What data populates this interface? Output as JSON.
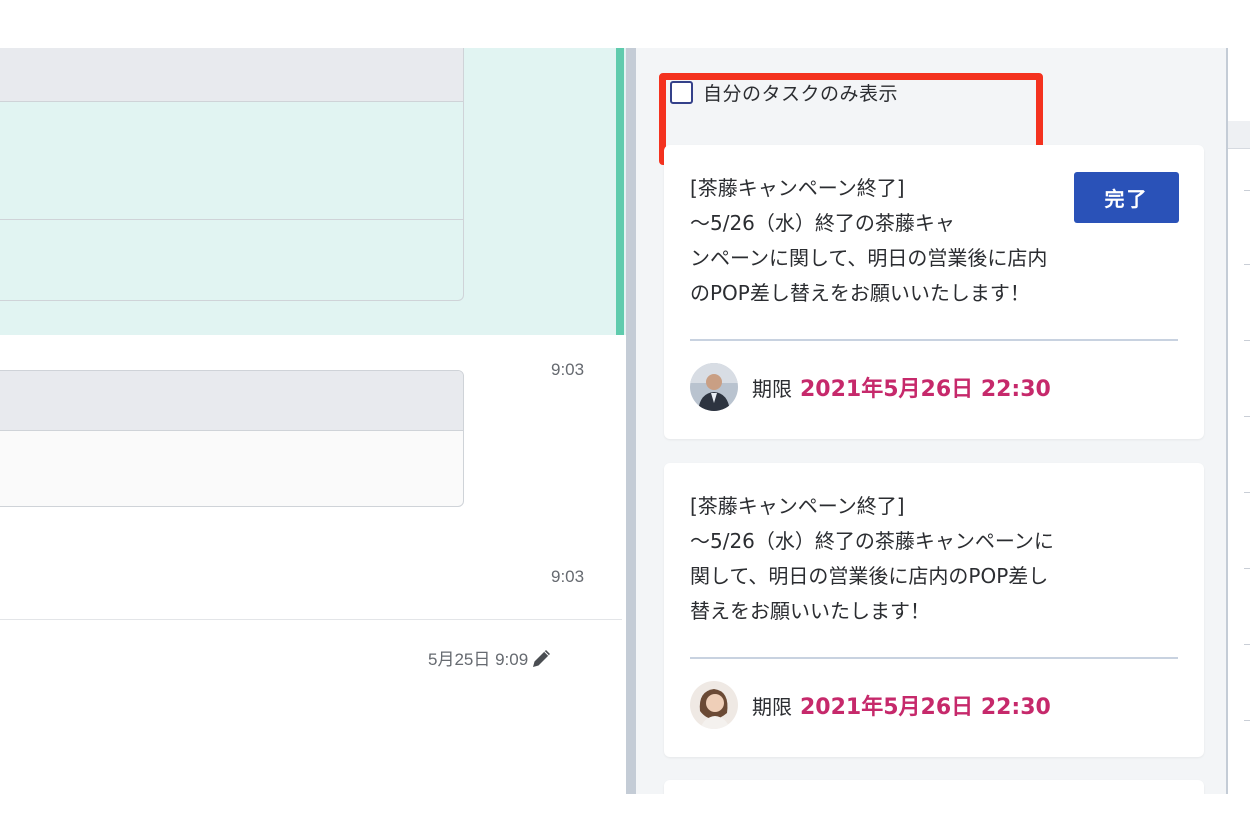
{
  "chat": {
    "times": [
      "9:03",
      "9:03"
    ],
    "edit_stamp": "5月25日 9:09"
  },
  "task_panel": {
    "filter_label": "自分のタスクのみ表示",
    "filter_checked": false,
    "tasks": [
      {
        "body": "[茶藤キャンペーン終了]\n〜5/26（水）終了の茶藤キャ\nンペーンに関して、明日の営業後に店内\nのPOP差し替えをお願いいたします！",
        "complete_label": "完了",
        "due_label": "期限",
        "due_date": "2021年5月26日 22:30"
      },
      {
        "body": "[茶藤キャンペーン終了]\n〜5/26（水）終了の茶藤キャンペーンに\n関して、明日の営業後に店内のPOP差し\n替えをお願いいたします！",
        "due_label": "期限",
        "due_date": "2021年5月26日 22:30"
      }
    ]
  },
  "colors": {
    "accent_blue": "#2a52b8",
    "due_pink": "#c6296b",
    "highlight_red": "#f4321f",
    "unread_bar": "#5fcbad"
  },
  "icons": [
    "pencil-icon",
    "avatar-man",
    "avatar-woman",
    "checkbox"
  ]
}
